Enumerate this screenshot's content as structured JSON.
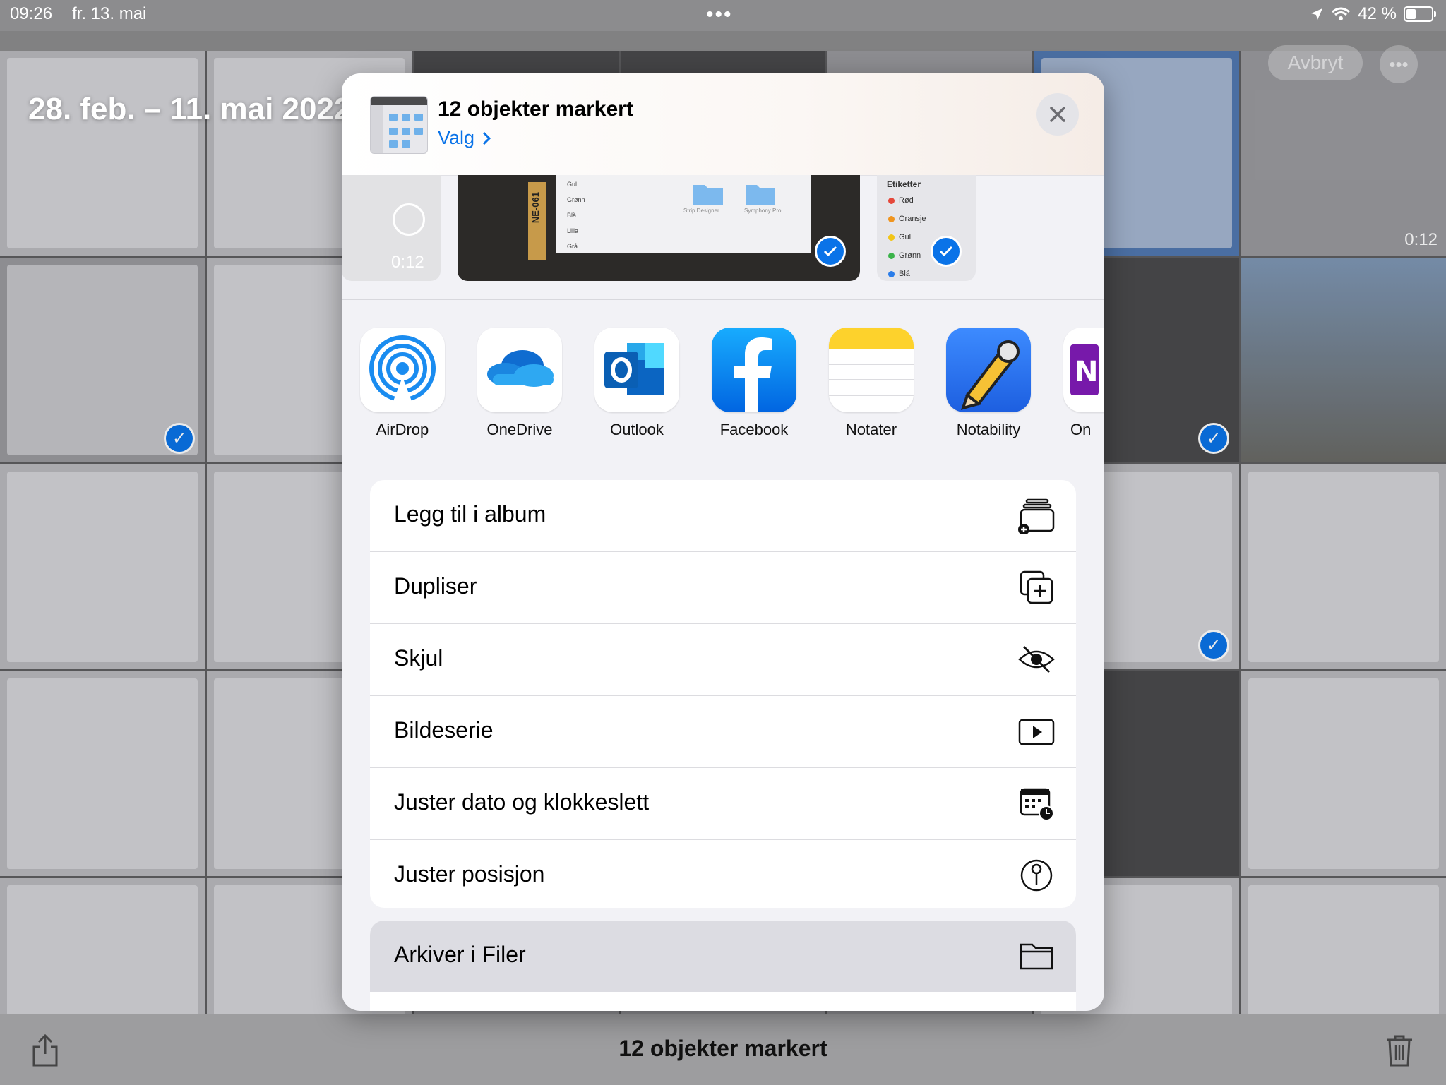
{
  "status": {
    "time": "09:26",
    "date": "fr. 13. mai",
    "battery": "42 %",
    "battery_level": 0.42
  },
  "library": {
    "range_title": "28. feb. – 11. mai 2022",
    "cancel_label": "Avbryt",
    "more_label": "•••",
    "durations": [
      "0:12"
    ]
  },
  "toolbar": {
    "selection_label": "12 objekter markert"
  },
  "sheet": {
    "title": "12 objekter markert",
    "options_label": "Valg",
    "strip": {
      "video_duration": "0:12",
      "label_title": "Etiketter",
      "labels": [
        {
          "name": "Rød",
          "color": "#e5483b"
        },
        {
          "name": "Oransje",
          "color": "#f0951f"
        },
        {
          "name": "Gul",
          "color": "#f2c517"
        },
        {
          "name": "Grønn",
          "color": "#3bb34a"
        },
        {
          "name": "Blå",
          "color": "#2b7de9"
        }
      ],
      "mini_labels": [
        {
          "name": "Gul",
          "color": "#f2c517"
        },
        {
          "name": "Grønn",
          "color": "#3bb34a"
        },
        {
          "name": "Blå",
          "color": "#2b7de9"
        },
        {
          "name": "Lilla",
          "color": "#b25ad8"
        },
        {
          "name": "Grå",
          "color": "#9b9b9b"
        }
      ],
      "folder_labels": [
        "Strip Designer",
        "Symphony Pro"
      ],
      "tape_text": "NE-061"
    },
    "apps": [
      {
        "name": "AirDrop",
        "icon": "airdrop-icon"
      },
      {
        "name": "OneDrive",
        "icon": "onedrive-icon"
      },
      {
        "name": "Outlook",
        "icon": "outlook-icon"
      },
      {
        "name": "Facebook",
        "icon": "facebook-icon"
      },
      {
        "name": "Notater",
        "icon": "notes-icon"
      },
      {
        "name": "Notability",
        "icon": "notability-icon"
      },
      {
        "name": "On",
        "icon": "onenote-icon"
      }
    ],
    "actions": [
      {
        "label": "Legg til i album",
        "icon": "add-to-album-icon"
      },
      {
        "label": "Dupliser",
        "icon": "duplicate-icon"
      },
      {
        "label": "Skjul",
        "icon": "hide-eye-icon"
      },
      {
        "label": "Bildeserie",
        "icon": "slideshow-icon"
      },
      {
        "label": "Juster dato og klokkeslett",
        "icon": "calendar-clock-icon"
      },
      {
        "label": "Juster posisjon",
        "icon": "location-pin-icon"
      }
    ],
    "save_action": {
      "label": "Arkiver i Filer",
      "icon": "folder-icon"
    }
  },
  "colors": {
    "accent": "#0a73e8",
    "sheet_bg": "#f2f2f6"
  }
}
